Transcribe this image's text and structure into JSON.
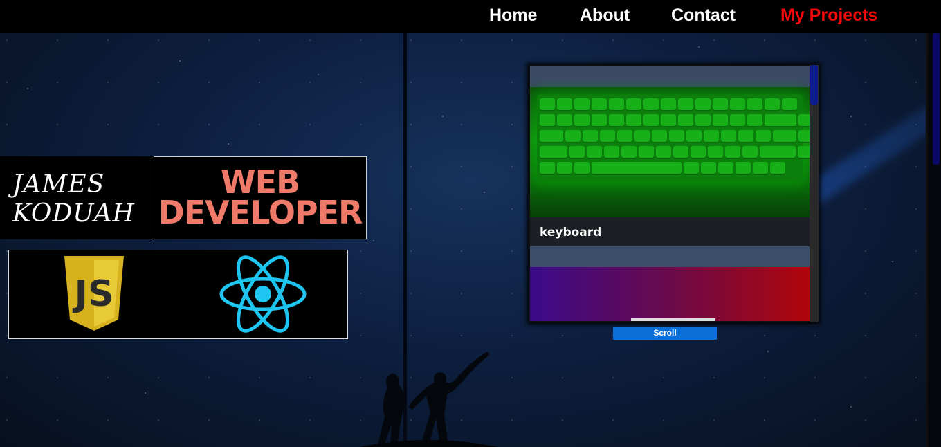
{
  "nav": {
    "items": [
      {
        "label": "Home",
        "active": false
      },
      {
        "label": "About",
        "active": false
      },
      {
        "label": "Contact",
        "active": false
      },
      {
        "label": "My Projects",
        "active": true
      }
    ],
    "active_color": "#f40808"
  },
  "hero": {
    "name": "JAMES\nKODUAH",
    "title": "WEB\nDEVELOPER",
    "title_color": "#f07a6a"
  },
  "logos": [
    {
      "icon": "javascript-logo-icon",
      "label": "JS"
    },
    {
      "icon": "react-logo-icon"
    }
  ],
  "projects": {
    "items": [
      {
        "caption": "keyboard"
      },
      {
        "caption": ""
      }
    ],
    "scroll_button_label": "Scroll"
  },
  "colors": {
    "accent_blue": "#0a6fd6",
    "react_blue": "#1ec5f0",
    "js_yellow": "#e4c02a"
  }
}
